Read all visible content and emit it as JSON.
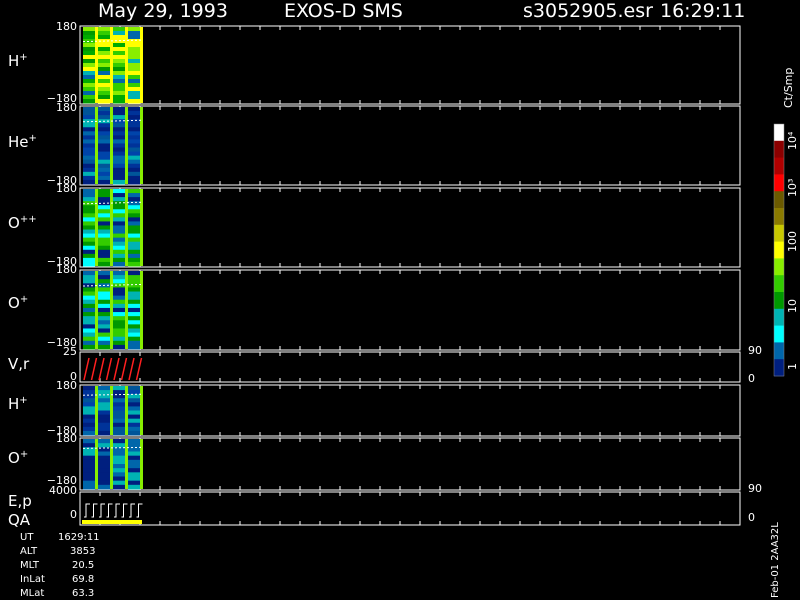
{
  "header": {
    "date": "May 29, 1993",
    "instrument": "EXOS-D SMS",
    "file": "s3052905.esr",
    "time": "16:29:11"
  },
  "panels": [
    {
      "label_main": "H",
      "label_sup": "+",
      "y_top": "180",
      "y_bottom": "−180"
    },
    {
      "label_main": "He",
      "label_sup": "+",
      "y_top": "180",
      "y_bottom": "−180"
    },
    {
      "label_main": "O",
      "label_sup": "++",
      "y_top": "180",
      "y_bottom": "−180"
    },
    {
      "label_main": "O",
      "label_sup": "+",
      "y_top": "180",
      "y_bottom": "−180"
    },
    {
      "label_main": "V,r",
      "label_sup": "",
      "y_top": "25",
      "y_bottom": "0",
      "r_top": "90",
      "r_bottom": "0"
    },
    {
      "label_main": "H",
      "label_sup": "+",
      "y_top": "180",
      "y_bottom": "−180"
    },
    {
      "label_main": "O",
      "label_sup": "+",
      "y_top": "180",
      "y_bottom": "−180"
    },
    {
      "label_main": "E,p",
      "label_sup": "",
      "label_extra": "QA",
      "y_top": "4000",
      "y_bottom": "0",
      "r_top": "90",
      "r_bottom": "0"
    }
  ],
  "colorbar": {
    "unit": "Ct/Smp",
    "labels": [
      "10⁴",
      "10³",
      "100",
      "10",
      "1"
    ],
    "colors": [
      "#ffffff",
      "#8b0000",
      "#b00000",
      "#ff0000",
      "#6b5a00",
      "#8a7a00",
      "#c8c800",
      "#ffff00",
      "#88ee00",
      "#33cc00",
      "#009900",
      "#00b3b3",
      "#00ffff",
      "#0066aa",
      "#001f7f"
    ]
  },
  "ephemeris": [
    {
      "name": "UT",
      "value": "1629:11"
    },
    {
      "name": "ALT",
      "value": "3853"
    },
    {
      "name": "MLT",
      "value": "20.5"
    },
    {
      "name": "InLat",
      "value": "69.8"
    },
    {
      "name": "MLat",
      "value": "63.3"
    }
  ],
  "footer_vertical": "Feb-01 2AA32L",
  "chart_data": {
    "type": "heatmap",
    "title": "May 29, 1993   EXOS-D SMS",
    "data_columns": 4,
    "column_colors_h": [
      "#00aa00",
      "#ffff00",
      "#33cc00",
      "#ffff00"
    ],
    "grid": "off"
  }
}
